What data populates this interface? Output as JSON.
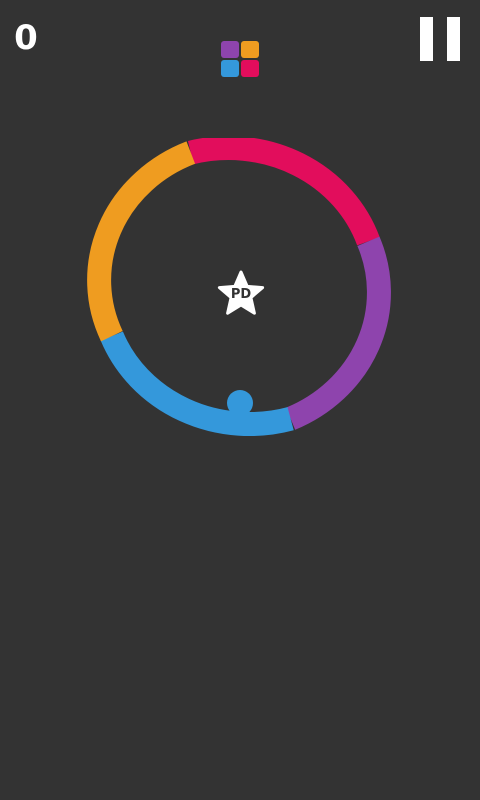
{
  "game": {
    "score": "0",
    "star_label": "PD"
  },
  "colors": {
    "background": "#333333",
    "foreground": "#ffffff",
    "magenta": "#e20d5c",
    "purple": "#8e44ad",
    "blue": "#3498db",
    "orange": "#ef9c20"
  },
  "color_switcher": {
    "top_left": "#8e44ad",
    "top_right": "#ef9c20",
    "bottom_left": "#3498db",
    "bottom_right": "#e20d5c"
  },
  "ring": {
    "segments": [
      {
        "name": "magenta",
        "color": "#e20d5c"
      },
      {
        "name": "purple",
        "color": "#8e44ad"
      },
      {
        "name": "blue",
        "color": "#3498db"
      },
      {
        "name": "orange",
        "color": "#ef9c20"
      }
    ]
  },
  "ball": {
    "color": "#3498db"
  },
  "icons": {
    "pause": "pause-icon",
    "star": "star-icon",
    "color_switcher": "color-switcher-icon"
  }
}
